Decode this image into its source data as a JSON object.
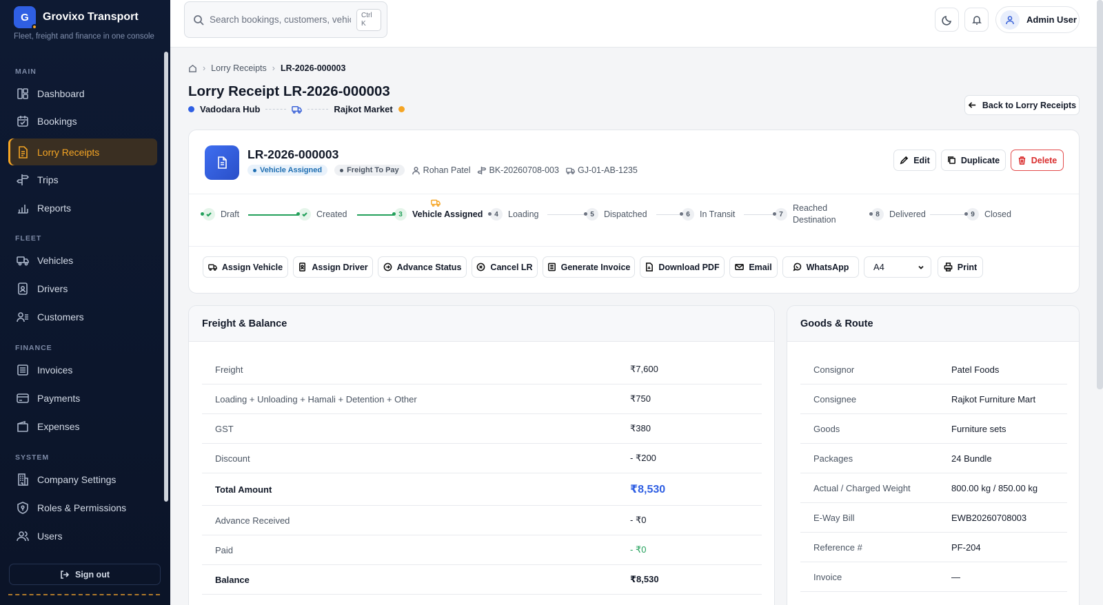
{
  "brand": {
    "initial": "G",
    "name": "Grovixo Transport",
    "tagline": "Fleet, freight and finance in one console"
  },
  "sidebar": {
    "sections": [
      {
        "label": "MAIN"
      },
      {
        "label": "FLEET"
      },
      {
        "label": "FINANCE"
      },
      {
        "label": "SYSTEM"
      }
    ],
    "items": [
      {
        "label": "Dashboard",
        "icon": "dashboard-icon"
      },
      {
        "label": "Bookings",
        "icon": "calendar-check-icon"
      },
      {
        "label": "Lorry Receipts",
        "icon": "receipt-icon",
        "active": true
      },
      {
        "label": "Trips",
        "icon": "signpost-icon"
      },
      {
        "label": "Reports",
        "icon": "bar-chart-icon"
      },
      {
        "label": "Vehicles",
        "icon": "truck-icon"
      },
      {
        "label": "Drivers",
        "icon": "id-badge-icon"
      },
      {
        "label": "Customers",
        "icon": "users-icon"
      },
      {
        "label": "Invoices",
        "icon": "invoice-icon"
      },
      {
        "label": "Payments",
        "icon": "credit-card-icon"
      },
      {
        "label": "Expenses",
        "icon": "wallet-icon"
      },
      {
        "label": "Company Settings",
        "icon": "building-icon"
      },
      {
        "label": "Roles & Permissions",
        "icon": "shield-icon"
      },
      {
        "label": "Users",
        "icon": "users-group-icon"
      }
    ],
    "signout": "Sign out"
  },
  "topbar": {
    "search_placeholder": "Search bookings, customers, vehicles",
    "shortcut": "Ctrl K",
    "user": "Admin User"
  },
  "breadcrumb": {
    "parent": "Lorry Receipts",
    "current": "LR-2026-000003"
  },
  "page": {
    "title": "Lorry Receipt LR-2026-000003",
    "origin": "Vadodara Hub",
    "destination": "Rajkot Market",
    "back": "Back to Lorry Receipts"
  },
  "colors": {
    "accent": "#2f5fe3",
    "warning": "#f5a524",
    "success": "#22a05a",
    "danger": "#d92d2d"
  },
  "lr": {
    "number": "LR-2026-000003",
    "status": "Vehicle Assigned",
    "payment_type": "Freight To Pay",
    "customer": "Rohan Patel",
    "booking": "BK-20260708-003",
    "vehicle": "GJ-01-AB-1235",
    "actions": {
      "edit": "Edit",
      "duplicate": "Duplicate",
      "delete": "Delete"
    }
  },
  "steps": [
    {
      "num": "",
      "label": "Draft",
      "state": "done"
    },
    {
      "num": "",
      "label": "Created",
      "state": "done"
    },
    {
      "num": "3",
      "label": "Vehicle Assigned",
      "state": "current"
    },
    {
      "num": "4",
      "label": "Loading",
      "state": "pending"
    },
    {
      "num": "5",
      "label": "Dispatched",
      "state": "pending"
    },
    {
      "num": "6",
      "label": "In Transit",
      "state": "pending"
    },
    {
      "num": "7",
      "label": "Reached Destination",
      "state": "pending"
    },
    {
      "num": "8",
      "label": "Delivered",
      "state": "pending"
    },
    {
      "num": "9",
      "label": "Closed",
      "state": "pending"
    }
  ],
  "toolbar": {
    "assign_vehicle": "Assign Vehicle",
    "assign_driver": "Assign Driver",
    "advance_status": "Advance Status",
    "cancel_lr": "Cancel LR",
    "generate_invoice": "Generate Invoice",
    "download_pdf": "Download PDF",
    "email": "Email",
    "whatsapp": "WhatsApp",
    "paper_size": "A4",
    "print": "Print"
  },
  "freight": {
    "title": "Freight & Balance",
    "rows": [
      {
        "label": "Freight",
        "value": "₹7,600"
      },
      {
        "label": "Loading + Unloading + Hamali + Detention + Other",
        "value": "₹750"
      },
      {
        "label": "GST",
        "value": "₹380"
      },
      {
        "label": "Discount",
        "value": "- ₹200"
      },
      {
        "label": "Total Amount",
        "value": "₹8,530"
      },
      {
        "label": "Advance Received",
        "value": "- ₹0"
      },
      {
        "label": "Paid",
        "value": "- ₹0"
      },
      {
        "label": "Balance",
        "value": "₹8,530"
      }
    ]
  },
  "goods": {
    "title": "Goods & Route",
    "rows": [
      {
        "label": "Consignor",
        "value": "Patel Foods"
      },
      {
        "label": "Consignee",
        "value": "Rajkot Furniture Mart"
      },
      {
        "label": "Goods",
        "value": "Furniture sets"
      },
      {
        "label": "Packages",
        "value": "24 Bundle"
      },
      {
        "label": "Actual / Charged Weight",
        "value": "800.00 kg / 850.00 kg"
      },
      {
        "label": "E-Way Bill",
        "value": "EWB20260708003"
      },
      {
        "label": "Reference #",
        "value": "PF-204"
      },
      {
        "label": "Invoice",
        "value": "—"
      }
    ]
  }
}
